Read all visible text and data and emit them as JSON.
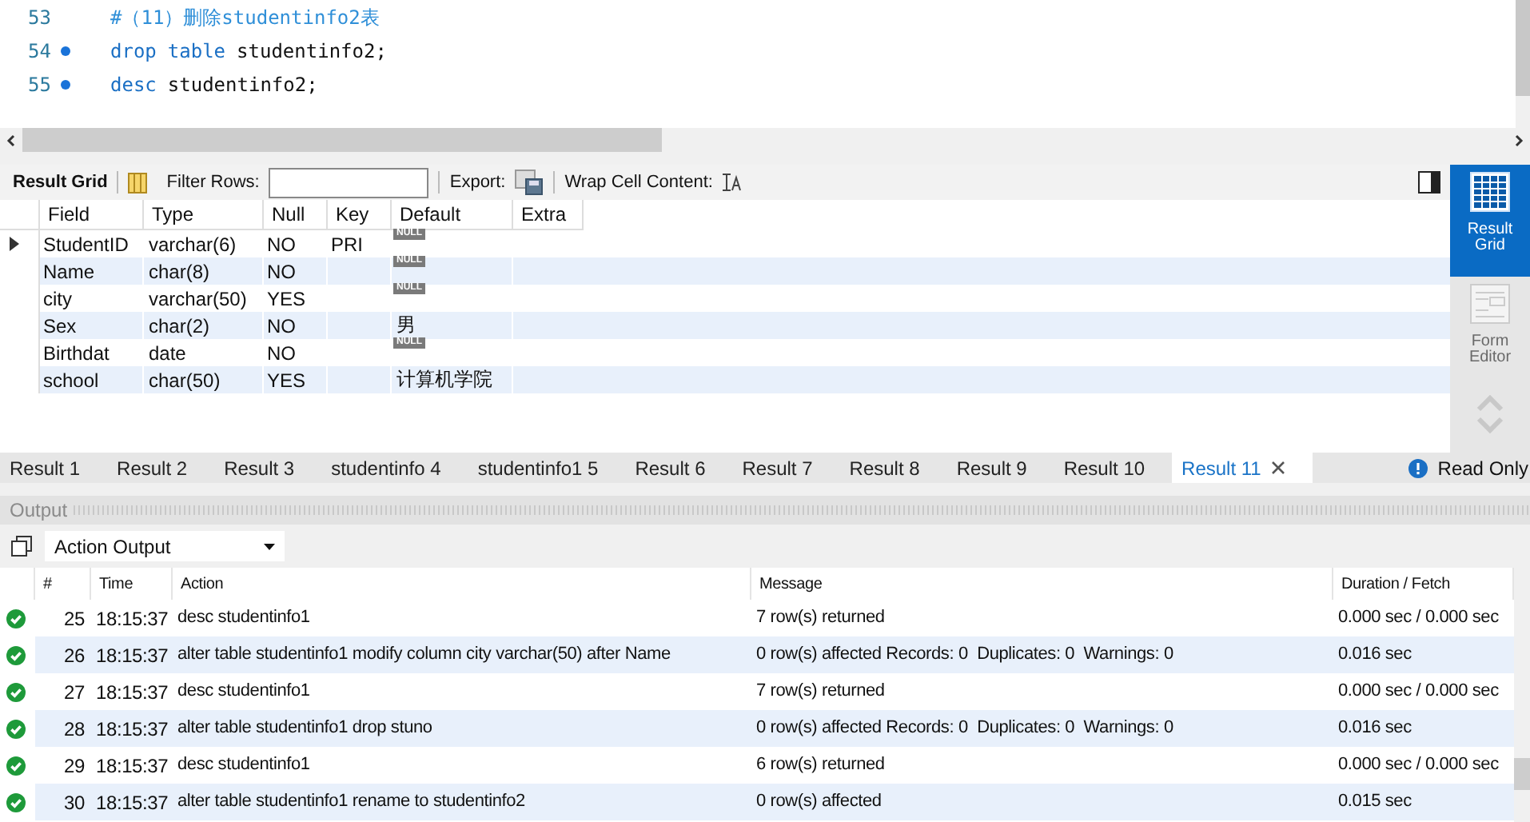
{
  "editor": {
    "lines": [
      {
        "number": "53",
        "breakpoint": false,
        "tokens": [
          {
            "kind": "comment",
            "text": "#（11）删除studentinfo2表"
          }
        ]
      },
      {
        "number": "54",
        "breakpoint": true,
        "tokens": [
          {
            "kind": "keyword",
            "text": "drop"
          },
          {
            "kind": "keyword",
            "text": "table"
          },
          {
            "kind": "plain",
            "text": "studentinfo2;"
          }
        ]
      },
      {
        "number": "55",
        "breakpoint": true,
        "tokens": [
          {
            "kind": "keyword",
            "text": "desc"
          },
          {
            "kind": "plain",
            "text": "studentinfo2;"
          }
        ]
      }
    ]
  },
  "result_toolbar": {
    "title": "Result Grid",
    "filter_label": "Filter Rows:",
    "export_label": "Export:",
    "wrap_label": "Wrap Cell Content:"
  },
  "grid": {
    "columns": [
      "Field",
      "Type",
      "Null",
      "Key",
      "Default",
      "Extra"
    ],
    "rows": [
      {
        "current": true,
        "field": "StudentID",
        "type": "varchar(6)",
        "null": "NO",
        "key": "PRI",
        "default": {
          "kind": "null",
          "text": "NULL"
        }
      },
      {
        "current": false,
        "field": "Name",
        "type": "char(8)",
        "null": "NO",
        "default": {
          "kind": "null",
          "text": "NULL"
        }
      },
      {
        "current": false,
        "field": "city",
        "type": "varchar(50)",
        "null": "YES",
        "default": {
          "kind": "null",
          "text": "NULL"
        }
      },
      {
        "current": false,
        "field": "Sex",
        "type": "char(2)",
        "null": "NO",
        "default": {
          "kind": "text",
          "text": "男"
        }
      },
      {
        "current": false,
        "field": "Birthdat",
        "type": "date",
        "null": "NO",
        "default": {
          "kind": "null",
          "text": "NULL"
        }
      },
      {
        "current": false,
        "field": "school",
        "type": "char(50)",
        "null": "YES",
        "default": {
          "kind": "text",
          "text": "计算机学院"
        }
      }
    ]
  },
  "side_panel": [
    {
      "label": "Result Grid",
      "selected": true
    },
    {
      "label": "Form Editor",
      "selected": false
    }
  ],
  "result_tabs": [
    {
      "label": "Result 1",
      "selected": false
    },
    {
      "label": "Result 2",
      "selected": false
    },
    {
      "label": "Result 3",
      "selected": false
    },
    {
      "label": "studentinfo 4",
      "selected": false
    },
    {
      "label": "studentinfo1 5",
      "selected": false
    },
    {
      "label": "Result 6",
      "selected": false
    },
    {
      "label": "Result 7",
      "selected": false
    },
    {
      "label": "Result 8",
      "selected": false
    },
    {
      "label": "Result 9",
      "selected": false
    },
    {
      "label": "Result 10",
      "selected": false
    },
    {
      "label": "Result 11",
      "selected": true
    }
  ],
  "read_only": "Read Only",
  "output": {
    "title": "Output",
    "selector": "Action Output",
    "columns": [
      "#",
      "Time",
      "Action",
      "Message",
      "Duration / Fetch"
    ],
    "rows": [
      {
        "number": "25",
        "time": "18:15:37",
        "action": "desc studentinfo1",
        "message": "7 row(s) returned",
        "duration": "0.000 sec / 0.000 sec"
      },
      {
        "number": "26",
        "time": "18:15:37",
        "action": "alter table studentinfo1 modify column city varchar(50) after Name",
        "message": "0 row(s) affected Records: 0  Duplicates: 0  Warnings: 0",
        "duration": "0.016 sec"
      },
      {
        "number": "27",
        "time": "18:15:37",
        "action": "desc studentinfo1",
        "message": "7 row(s) returned",
        "duration": "0.000 sec / 0.000 sec"
      },
      {
        "number": "28",
        "time": "18:15:37",
        "action": "alter table studentinfo1 drop stuno",
        "message": "0 row(s) affected Records: 0  Duplicates: 0  Warnings: 0",
        "duration": "0.016 sec"
      },
      {
        "number": "29",
        "time": "18:15:37",
        "action": "desc studentinfo1",
        "message": "6 row(s) returned",
        "duration": "0.000 sec / 0.000 sec"
      },
      {
        "number": "30",
        "time": "18:15:37",
        "action": "alter table studentinfo1 rename to studentinfo2",
        "message": "0 row(s) affected",
        "duration": "0.015 sec"
      }
    ]
  }
}
